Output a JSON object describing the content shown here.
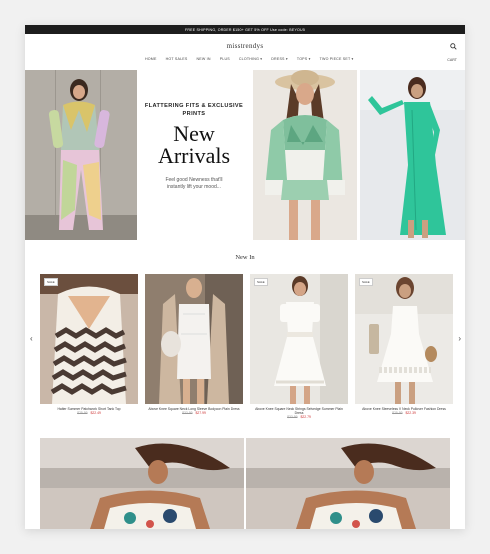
{
  "topbar": {
    "text": "FREE SHIPPING, ORDER $150+ GET 5% OFF Use code: BEYOU5"
  },
  "brand": {
    "logo": "misstrendys"
  },
  "nav": {
    "items": [
      "HOME",
      "HOT SALES",
      "NEW IN",
      "PLUS",
      "CLOTHING ▾",
      "DRESS ▾",
      "TOPS ▾",
      "TWO PIECE SET ▾"
    ],
    "cart": "CART"
  },
  "hero": {
    "tagline": "FLATTERING FITS & EXCLUSIVE PRINTS",
    "title_line1": "New",
    "title_line2": "Arrivals",
    "subtitle": "Feel good Newness that'll instantly lift your mood..."
  },
  "new_in": {
    "title": "New In",
    "products": [
      {
        "sale": "SALE",
        "name": "Halter Summer Patchwork Short Tank Top",
        "old_price": "$25.99",
        "price": "$22.49"
      },
      {
        "sale": "",
        "name": "Above Knee Square Neck Long Sleeve Bodycon Plain Dress",
        "old_price": "$33.99",
        "price": "$27.99"
      },
      {
        "sale": "SALE",
        "name": "Above Knee Square Neck Strings Selvedge Summer Plain Dress",
        "old_price": "$33.99",
        "price": "$22.79"
      },
      {
        "sale": "SALE",
        "name": "Above Knee Sleeveless V Neck Pullover Fashion Dress",
        "old_price": "$25.99",
        "price": "$22.39"
      }
    ],
    "prev": "‹",
    "next": "›"
  },
  "colors": {
    "accent": "#c33333",
    "topbar": "#1d1d1d"
  },
  "icons": [
    "search-icon",
    "chevron-left-icon",
    "chevron-right-icon"
  ]
}
